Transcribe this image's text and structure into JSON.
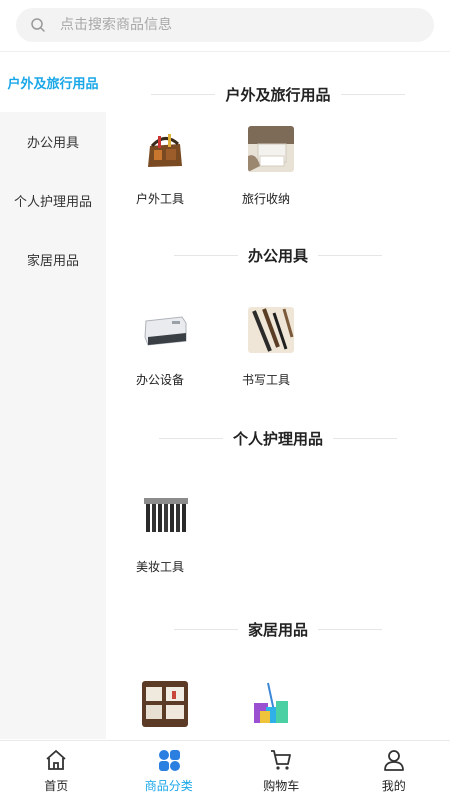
{
  "search": {
    "placeholder": "点击搜索商品信息"
  },
  "sidebar": {
    "items": [
      {
        "label": "户外及旅行用品",
        "active": true
      },
      {
        "label": "办公用具",
        "active": false
      },
      {
        "label": "个人护理用品",
        "active": false
      },
      {
        "label": "家居用品",
        "active": false
      }
    ]
  },
  "sections": [
    {
      "title": "户外及旅行用品",
      "items": [
        {
          "label": "户外工具"
        },
        {
          "label": "旅行收纳"
        }
      ]
    },
    {
      "title": "办公用具",
      "items": [
        {
          "label": "办公设备"
        },
        {
          "label": "书写工具"
        }
      ]
    },
    {
      "title": "个人护理用品",
      "items": [
        {
          "label": "美妆工具"
        }
      ]
    },
    {
      "title": "家居用品",
      "items": [
        {
          "label": ""
        },
        {
          "label": ""
        }
      ]
    }
  ],
  "tabbar": {
    "items": [
      {
        "label": "首页",
        "icon": "home-icon"
      },
      {
        "label": "商品分类",
        "icon": "category-icon",
        "active": true
      },
      {
        "label": "购物车",
        "icon": "cart-icon"
      },
      {
        "label": "我的",
        "icon": "user-icon"
      }
    ]
  },
  "colors": {
    "accent": "#1aa7e8",
    "sidebar_bg": "#f6f6f6"
  }
}
